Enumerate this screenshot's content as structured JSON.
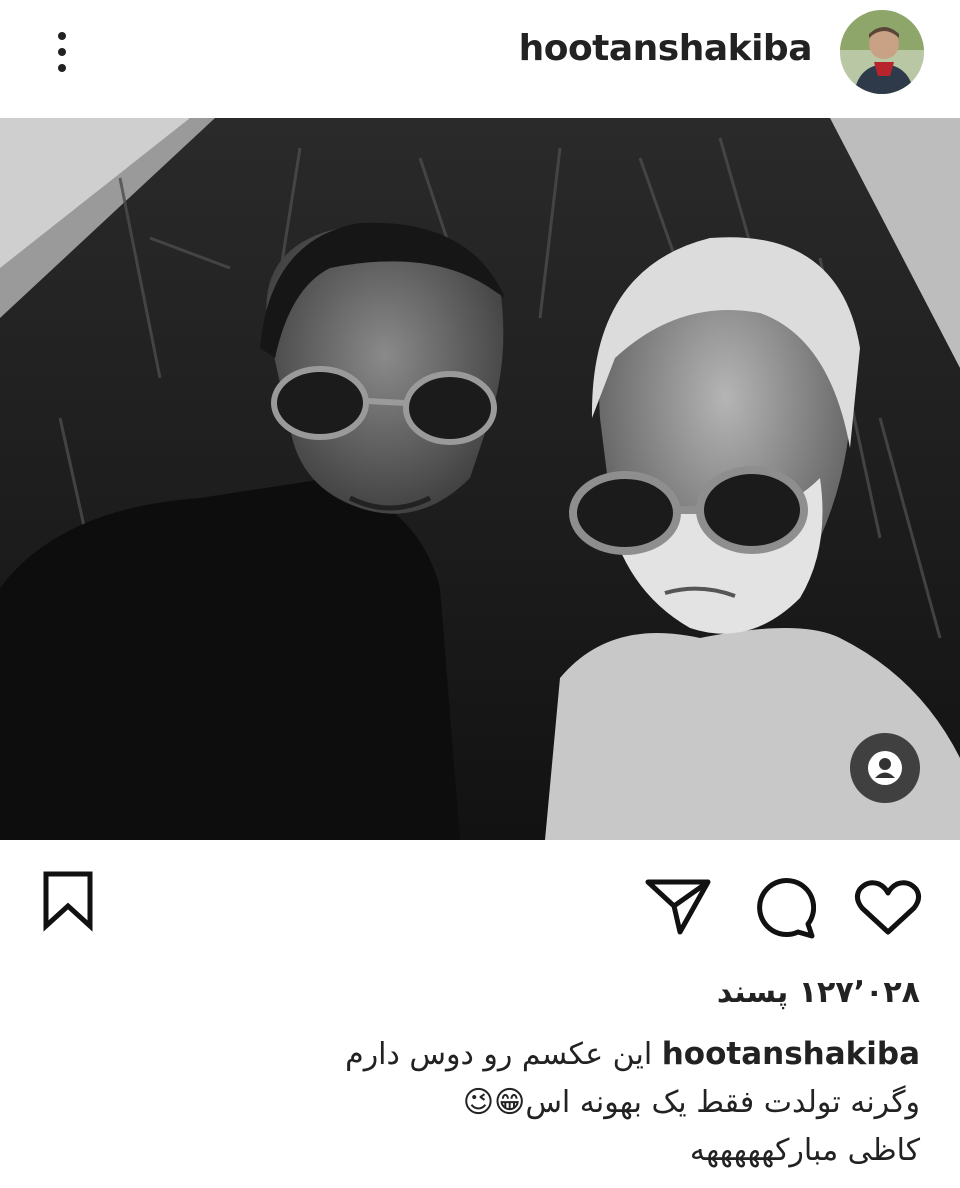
{
  "header": {
    "username": "hootanshakiba",
    "more_icon": "more-vertical-icon"
  },
  "post": {
    "tag_icon": "user-tag-icon"
  },
  "actions": {
    "save_icon": "bookmark-icon",
    "share_icon": "send-icon",
    "comment_icon": "comment-icon",
    "like_icon": "heart-icon"
  },
  "likes": "۱۲۷٬۰۲۸ پسند",
  "caption": {
    "username": "hootanshakiba",
    "line1": "این عکسم رو دوس دارم",
    "line2": "وگرنه تولدت فقط یک بهونه اس😁😉",
    "line3": "کاظی مبارکهههههه"
  }
}
